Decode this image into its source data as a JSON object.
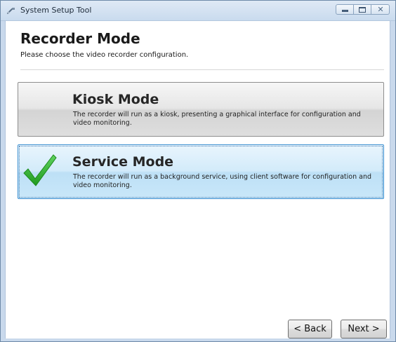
{
  "window": {
    "title": "System Setup Tool",
    "app_icon": "tool-icon",
    "controls": {
      "minimize_icon": "minimize-icon",
      "maximize_icon": "maximize-icon",
      "close_icon": "close-icon",
      "close_glyph": "✕"
    }
  },
  "page": {
    "title": "Recorder Mode",
    "subtitle": "Please choose the video recorder configuration."
  },
  "options": [
    {
      "title": "Kiosk Mode",
      "description": "The recorder will run as a kiosk, presenting a graphical interface for configuration and video monitoring.",
      "selected": false
    },
    {
      "title": "Service Mode",
      "description": "The recorder will run as a background service, using client software for configuration and video monitoring.",
      "selected": true,
      "icon": "checkmark-icon"
    }
  ],
  "navigation": {
    "back_label": "< Back",
    "next_label": "Next >"
  },
  "colors": {
    "selected_border": "#3c8fd0",
    "selected_fill": "#c9e7f9",
    "checkmark": "#2fb52f"
  }
}
